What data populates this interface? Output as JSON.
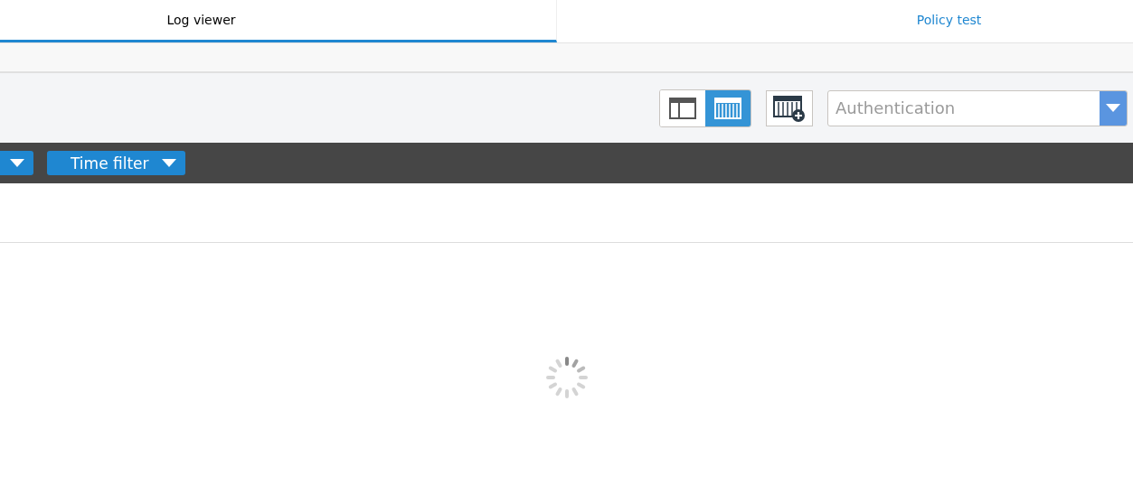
{
  "tabs": [
    {
      "label": "Log viewer",
      "selected": true
    },
    {
      "label": "Policy test",
      "selected": false
    }
  ],
  "view_toggle": [
    {
      "kind": "split",
      "selected": false
    },
    {
      "kind": "columns",
      "selected": true
    }
  ],
  "log_type_select": {
    "value": "Authentication"
  },
  "filters": [
    {
      "kind": "cut"
    },
    {
      "kind": "labeled",
      "label": "Time filter"
    }
  ],
  "loading": true
}
